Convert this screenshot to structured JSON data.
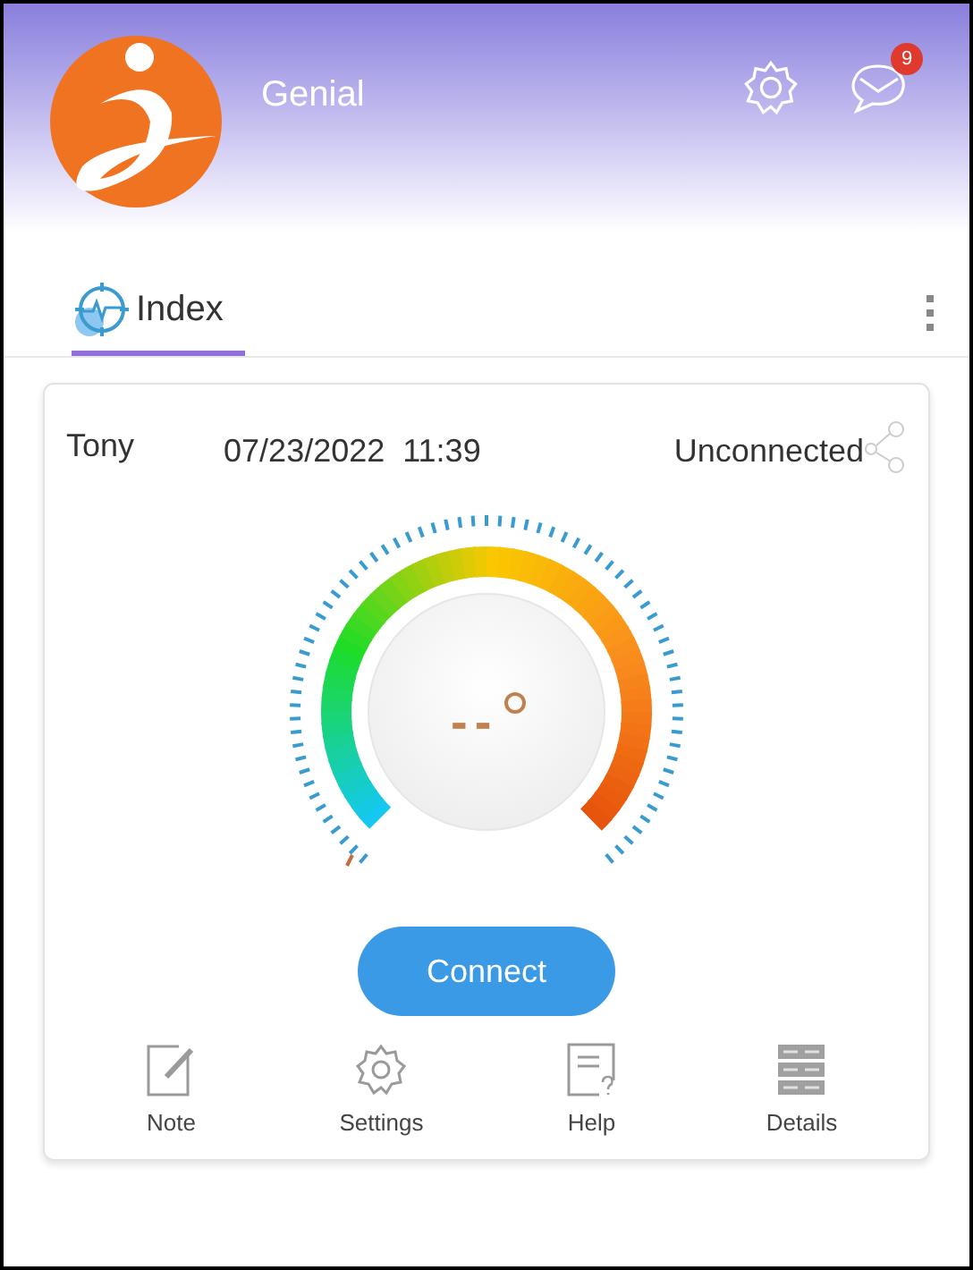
{
  "header": {
    "app_name": "Genial",
    "badge_count": "9"
  },
  "tabs": [
    {
      "label": "Index",
      "selected": true
    }
  ],
  "card": {
    "user": "Tony",
    "datetime": "07/23/2022  11:39",
    "status": "Unconnected",
    "reading": "--",
    "button": "Connect"
  },
  "actions": [
    {
      "label": "Note",
      "kind": "note"
    },
    {
      "label": "Settings",
      "kind": "settings"
    },
    {
      "label": "Help",
      "kind": "help"
    },
    {
      "label": "Details",
      "kind": "details"
    }
  ]
}
